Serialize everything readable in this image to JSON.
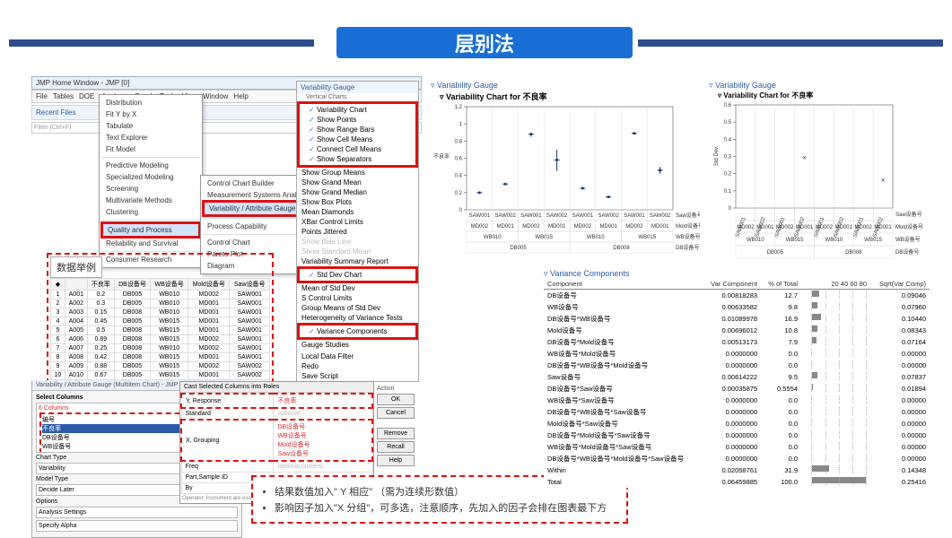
{
  "title": "层别法",
  "window": {
    "title": "JMP Home Window - JMP [0]"
  },
  "menubar": [
    "File",
    "Tables",
    "DOE",
    "Analyze",
    "Graph",
    "Tools",
    "View",
    "Window",
    "Help"
  ],
  "menubar_active": "Analyze",
  "recent": {
    "label": "Recent Files",
    "filter": "Filter (Ctrl+F)"
  },
  "analyze_menu": [
    "Distribution",
    "Fit Y by X",
    "Tabulate",
    "Text Explorer",
    "Fit Model",
    "—",
    "Predictive Modeling",
    "Specialized Modeling",
    "Screening",
    "Multivariate Methods",
    "Clustering",
    "—",
    "Quality and Process",
    "Reliability and Survival",
    "—",
    "Consumer Research"
  ],
  "qap_submenu": [
    "Control Chart Builder",
    "Measurement Systems Analysis",
    "Variability / Attribute Gauge Chart",
    "—",
    "Process Capability",
    "—",
    "Control Chart",
    "Pareto Plot",
    "Diagram"
  ],
  "vg_menu": {
    "header": "Variability Gauge",
    "sections": [
      {
        "items": [
          "Vertical Charts"
        ]
      },
      {
        "checks": [
          "Variability Chart",
          "Show Points",
          "Show Range Bars",
          "Show Cell Means",
          "Connect Cell Means",
          "Show Separators"
        ]
      },
      {
        "items": [
          "Show Group Means",
          "Show Grand Mean",
          "Show Grand Median",
          "Show Box Plots",
          "Mean Diamonds",
          "XBar Control Limits",
          "Points Jittered",
          "Show Bias Line",
          "Show Standard Mean",
          "Variability Summary Report"
        ]
      },
      {
        "checks": [
          "Std Dev Chart"
        ]
      },
      {
        "items": [
          "Mean of Std Dev",
          "S Control Limits",
          "Group Means of Std Dev",
          "Heterogeneity of Variance Tests"
        ]
      },
      {
        "checks": [
          "Variance Components"
        ]
      },
      {
        "items": [
          "Gauge Studies"
        ]
      },
      {
        "items": [
          "Local Data Filter",
          "Redo",
          "Save Script"
        ]
      }
    ]
  },
  "data_table": {
    "caption": "数据举例",
    "headers": [
      "",
      "不良率",
      "DB设备号",
      "WB设备号",
      "Mold设备号",
      "Saw设备号"
    ],
    "rows": [
      [
        "1",
        "A001",
        "0.2",
        "DB005",
        "WB010",
        "MD002",
        "SAW001"
      ],
      [
        "2",
        "A002",
        "0.3",
        "DB005",
        "WB010",
        "MD001",
        "SAW001"
      ],
      [
        "3",
        "A003",
        "0.15",
        "DB008",
        "WB010",
        "MD001",
        "SAW001"
      ],
      [
        "4",
        "A004",
        "0.45",
        "DB005",
        "WB015",
        "MD001",
        "SAW001"
      ],
      [
        "5",
        "A005",
        "0.5",
        "DB008",
        "WB015",
        "MD001",
        "SAW001"
      ],
      [
        "6",
        "A006",
        "0.89",
        "DB008",
        "WB015",
        "MD002",
        "SAW001"
      ],
      [
        "7",
        "A007",
        "0.25",
        "DB008",
        "WB010",
        "MD002",
        "SAW001"
      ],
      [
        "8",
        "A008",
        "0.42",
        "DB008",
        "WB015",
        "MD001",
        "SAW001"
      ],
      [
        "9",
        "A009",
        "0.88",
        "DB005",
        "WB015",
        "MD002",
        "SAW002"
      ],
      [
        "10",
        "A010",
        "0.67",
        "DB005",
        "WB015",
        "MD001",
        "SAW002"
      ]
    ]
  },
  "selcol": {
    "title": "Select Columns",
    "columns_label": "6 Columns",
    "columns": [
      "编号",
      "不良率",
      "DB设备号",
      "WB设备号",
      "Mold设备号",
      "Saw设备号"
    ],
    "chart_type_label": "Chart Type",
    "chart_type": "Variability",
    "model_type_label": "Model Type",
    "model_type": "Decide Later",
    "options": "Options",
    "settings": [
      "Analysis Settings",
      "Specify Alpha"
    ],
    "vg_win": "Variability / Attribute Gauge (Multiitem Chart) - JMP [0]"
  },
  "roles": {
    "header": "Cast Selected Columns into Roles",
    "y": {
      "btn": "Y, Response",
      "val": "不良率"
    },
    "std": {
      "btn": "Standard",
      "val": "optional"
    },
    "x": {
      "btn": "X, Grouping",
      "vals": [
        "DB设备号",
        "WB设备号",
        "Mold设备号",
        "Saw设备号"
      ]
    },
    "freq": {
      "btn": "Freq",
      "val": "optional numeric"
    },
    "part": {
      "btn": "Part,Sample ID",
      "val": "optional"
    },
    "by": {
      "btn": "By",
      "val": "optional"
    },
    "note": "Operator, Instrument are examples of possible Grouping Cols"
  },
  "action": {
    "header": "Action",
    "buttons": [
      "OK",
      "Cancel",
      "",
      "Remove",
      "Recall",
      "Help"
    ]
  },
  "annot": [
    "结果数值加入\" Y 相应\" （需为连续形数值）",
    "影响因子加入\"X 分组\"，可多选，注意顺序，先加入的因子会排在图表最下方"
  ],
  "chart1": {
    "header": "Variability Gauge",
    "title": "Variability Chart for 不良率",
    "ylabel": "不良率",
    "y_axis": [
      0,
      0.2,
      0.4,
      0.6,
      0.8,
      1,
      1.2
    ],
    "saw_row": [
      "SAW001",
      "SAW002",
      "SAW001",
      "SAW002",
      "SAW001",
      "SAW002",
      "SAW001",
      "SAW002"
    ],
    "mold_row": [
      "MD002",
      "MD001",
      "MD002",
      "MD001",
      "MD002",
      "MD001",
      "MD002",
      "MD001"
    ],
    "wb_row": [
      "WB010",
      "WB015",
      "WB010",
      "WB015"
    ],
    "db_row": [
      "DB005",
      "DB008"
    ],
    "axis_labels": [
      "Saw设备号",
      "Mold设备号",
      "WB设备号",
      "DB设备号"
    ]
  },
  "chart2": {
    "header": "Variability Gauge",
    "title": "Variability Chart for 不良率",
    "ylabel": "Std Dev",
    "y_axis": [
      0,
      0.1,
      0.2,
      0.3,
      0.4,
      0.5,
      0.6
    ],
    "saw_row": [
      "SAW001",
      "SAW002",
      "SAW001",
      "SAW002",
      "SAW001",
      "SAW002",
      "SAW001",
      "SAW002"
    ],
    "mold_row": [
      "MD002",
      "MD001",
      "MD002",
      "MD001",
      "MD002",
      "MD001",
      "MD002",
      "MD001"
    ],
    "wb_row": [
      "WB010",
      "WB015",
      "WB010",
      "WB015"
    ],
    "db_row": [
      "DB005",
      "DB008"
    ],
    "axis_labels": [
      "Saw设备号",
      "Mold设备号",
      "WB设备号",
      "DB设备号"
    ]
  },
  "chart_data": [
    {
      "type": "scatter",
      "title": "Variability Chart for 不良率",
      "ylabel": "不良率",
      "ylim": [
        0,
        1.2
      ],
      "groups": [
        "DB005/WB010/MD002/SAW001",
        "DB005/WB010/MD002/SAW002",
        "DB005/WB010/MD001/SAW001",
        "DB005/WB010/MD001/SAW002",
        "DB005/WB015/MD002/SAW001",
        "DB005/WB015/MD002/SAW002",
        "DB005/WB015/MD001/SAW001",
        "DB005/WB015/MD001/SAW002",
        "DB008/WB010/MD002/SAW001",
        "DB008/WB010/MD001/SAW001",
        "DB008/WB015/MD002/SAW001",
        "DB008/WB015/MD001/SAW001"
      ],
      "ranges": [
        [
          0.2,
          0.2
        ],
        [
          0.3,
          0.3
        ],
        [
          0.85,
          0.9
        ],
        [
          0.45,
          0.7
        ],
        [
          0.25,
          0.25
        ],
        [
          0.15,
          0.15
        ],
        [
          0.89,
          0.89
        ],
        [
          0.42,
          0.5
        ]
      ],
      "means": [
        0.2,
        0.3,
        0.88,
        0.58,
        0.25,
        0.15,
        0.89,
        0.46
      ]
    },
    {
      "type": "scatter",
      "title": "Variability Chart for 不良率 (Std Dev)",
      "ylabel": "Std Dev",
      "ylim": [
        0,
        0.6
      ],
      "points": [
        {
          "x": "DB005/WB015/MD001/SAW002",
          "y": 0.28
        },
        {
          "x": "DB008/WB015/MD001/SAW001",
          "y": 0.15
        }
      ]
    }
  ],
  "vcomp": {
    "title": "Variance Components",
    "headers": [
      "Component",
      "Var Component",
      "% of Total",
      "20 40 60 80",
      "Sqrt(Var Comp)"
    ],
    "rows": [
      [
        "DB设备号",
        "0.00818283",
        "12.7",
        "",
        "0.09046"
      ],
      [
        "WB设备号",
        "0.00633582",
        "9.8",
        "",
        "0.07960"
      ],
      [
        "DB设备号*WB设备号",
        "0.01089978",
        "16.9",
        "",
        "0.10440"
      ],
      [
        "Mold设备号",
        "0.00696012",
        "10.8",
        "",
        "0.08343"
      ],
      [
        "DB设备号*Mold设备号",
        "0.00513173",
        "7.9",
        "",
        "0.07164"
      ],
      [
        "WB设备号*Mold设备号",
        "0.0000000",
        "0.0",
        "",
        "0.00000"
      ],
      [
        "DB设备号*WB设备号*Mold设备号",
        "0.0000000",
        "0.0",
        "",
        "0.00000"
      ],
      [
        "Saw设备号",
        "0.00614222",
        "9.5",
        "",
        "0.07837"
      ],
      [
        "DB设备号*Saw设备号",
        "0.00035875",
        "0.5554",
        "",
        "0.01894"
      ],
      [
        "WB设备号*Saw设备号",
        "0.0000000",
        "0.0",
        "",
        "0.00000"
      ],
      [
        "DB设备号*WB设备号*Saw设备号",
        "0.0000000",
        "0.0",
        "",
        "0.00000"
      ],
      [
        "Mold设备号*Saw设备号",
        "0.0000000",
        "0.0",
        "",
        "0.00000"
      ],
      [
        "DB设备号*Mold设备号*Saw设备号",
        "0.0000000",
        "0.0",
        "",
        "0.00000"
      ],
      [
        "WB设备号*Mold设备号*Saw设备号",
        "0.0000000",
        "0.0",
        "",
        "0.00000"
      ],
      [
        "DB设备号*WB设备号*Mold设备号*Saw设备号",
        "0.0000000",
        "0.0",
        "",
        "0.00000"
      ],
      [
        "Within",
        "0.02058761",
        "31.9",
        "",
        "0.14348"
      ],
      [
        "Total",
        "0.06459885",
        "100.0",
        "",
        "0.25416"
      ]
    ]
  }
}
